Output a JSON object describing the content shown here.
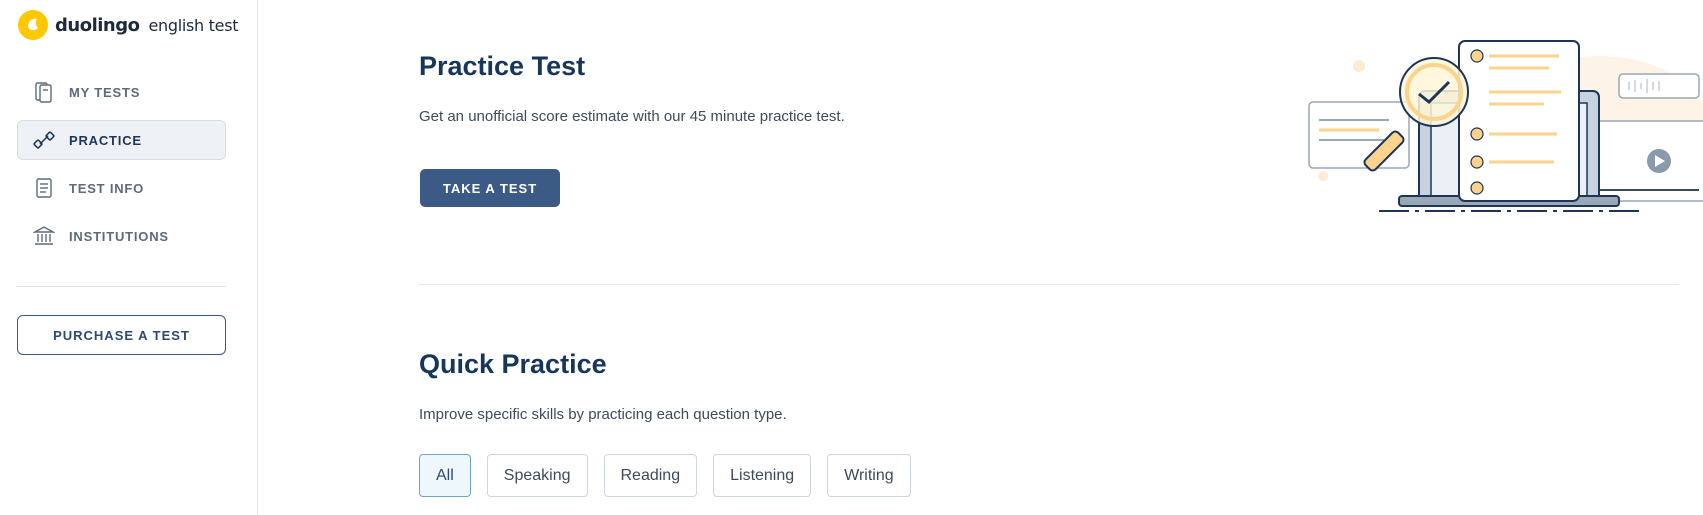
{
  "brand": {
    "name": "duolingo",
    "sub": "english test",
    "color": "#ffc800"
  },
  "sidebar": {
    "items": [
      {
        "label": "MY TESTS",
        "icon": "notebook-icon",
        "active": false
      },
      {
        "label": "PRACTICE",
        "icon": "dumbbell-icon",
        "active": true
      },
      {
        "label": "TEST INFO",
        "icon": "document-icon",
        "active": false
      },
      {
        "label": "INSTITUTIONS",
        "icon": "institution-icon",
        "active": false
      }
    ],
    "purchase_label": "PURCHASE A TEST"
  },
  "practice_test": {
    "title": "Practice Test",
    "description": "Get an unofficial score estimate with our 45 minute practice test.",
    "button_label": "TAKE A TEST"
  },
  "quick_practice": {
    "title": "Quick Practice",
    "description": "Improve specific skills by practicing each question type.",
    "filters": [
      {
        "label": "All",
        "active": true
      },
      {
        "label": "Speaking",
        "active": false
      },
      {
        "label": "Reading",
        "active": false
      },
      {
        "label": "Listening",
        "active": false
      },
      {
        "label": "Writing",
        "active": false
      }
    ]
  },
  "colors": {
    "accent": "#3c5a86",
    "title": "#16365c",
    "highlight": "#fbd38d"
  }
}
